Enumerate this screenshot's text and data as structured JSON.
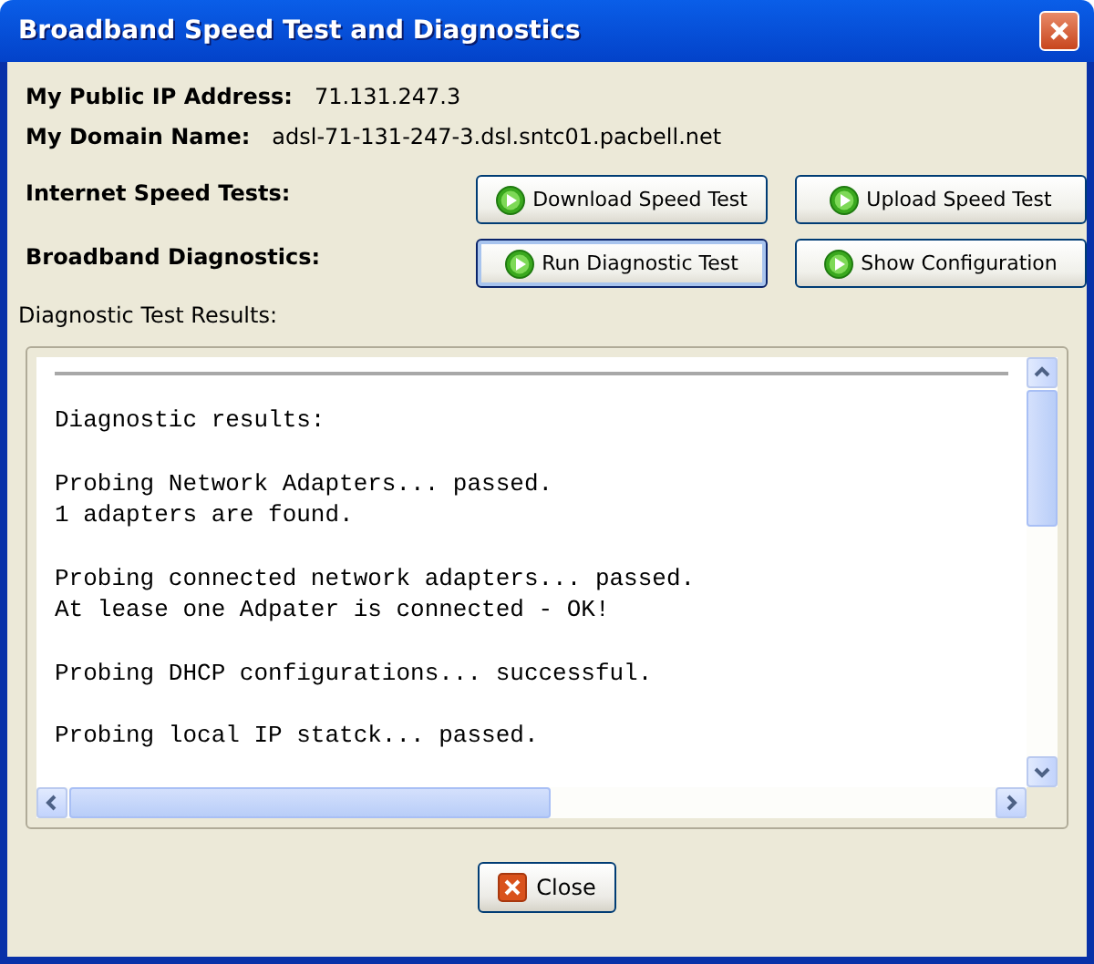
{
  "window": {
    "title": "Broadband Speed Test and Diagnostics"
  },
  "info": [
    {
      "label": "My Public IP Address:",
      "value": "71.131.247.3"
    },
    {
      "label": "My Domain Name:",
      "value": "adsl-71-131-247-3.dsl.sntc01.pacbell.net"
    }
  ],
  "action_rows": [
    {
      "label": "Internet Speed Tests:",
      "buttons": [
        {
          "label": "Download Speed Test",
          "focused": false
        },
        {
          "label": "Upload Speed Test",
          "focused": false
        }
      ]
    },
    {
      "label": "Broadband Diagnostics:",
      "buttons": [
        {
          "label": "Run Diagnostic Test",
          "focused": true
        },
        {
          "label": "Show Configuration",
          "focused": false
        }
      ]
    }
  ],
  "results": {
    "label": "Diagnostic Test Results:",
    "paragraphs": [
      [
        "Diagnostic results:"
      ],
      [
        "Probing Network Adapters... passed.",
        "1 adapters are found."
      ],
      [
        "Probing connected network adapters... passed.",
        "At lease one Adpater is connected - OK!"
      ],
      [
        "Probing DHCP configurations... successful."
      ],
      [
        "Probing local IP statck... passed."
      ]
    ]
  },
  "close_button": {
    "label": "Close"
  }
}
